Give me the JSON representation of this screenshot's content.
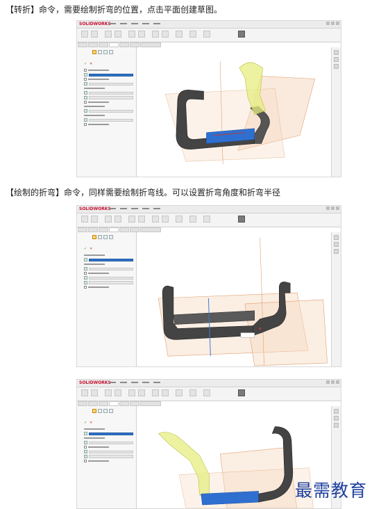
{
  "captions": {
    "first": "【转折】命令，需要绘制折弯的位置，点击平面创建草图。",
    "second": "【绘制的折弯】命令，同样需要绘制折弯线。可以设置折弯角度和折弯半径"
  },
  "app": {
    "logo_text": "SOLIDWORKS"
  },
  "watermark": "最需教育",
  "colors": {
    "part": "#444444",
    "selected_face": "#2f6fd0",
    "plane_fill": "#f6d9c2",
    "preview": "#e6ee80",
    "sketch_line": "#c0392b"
  },
  "icons": {
    "confirm": "✓",
    "cancel": "✕"
  }
}
